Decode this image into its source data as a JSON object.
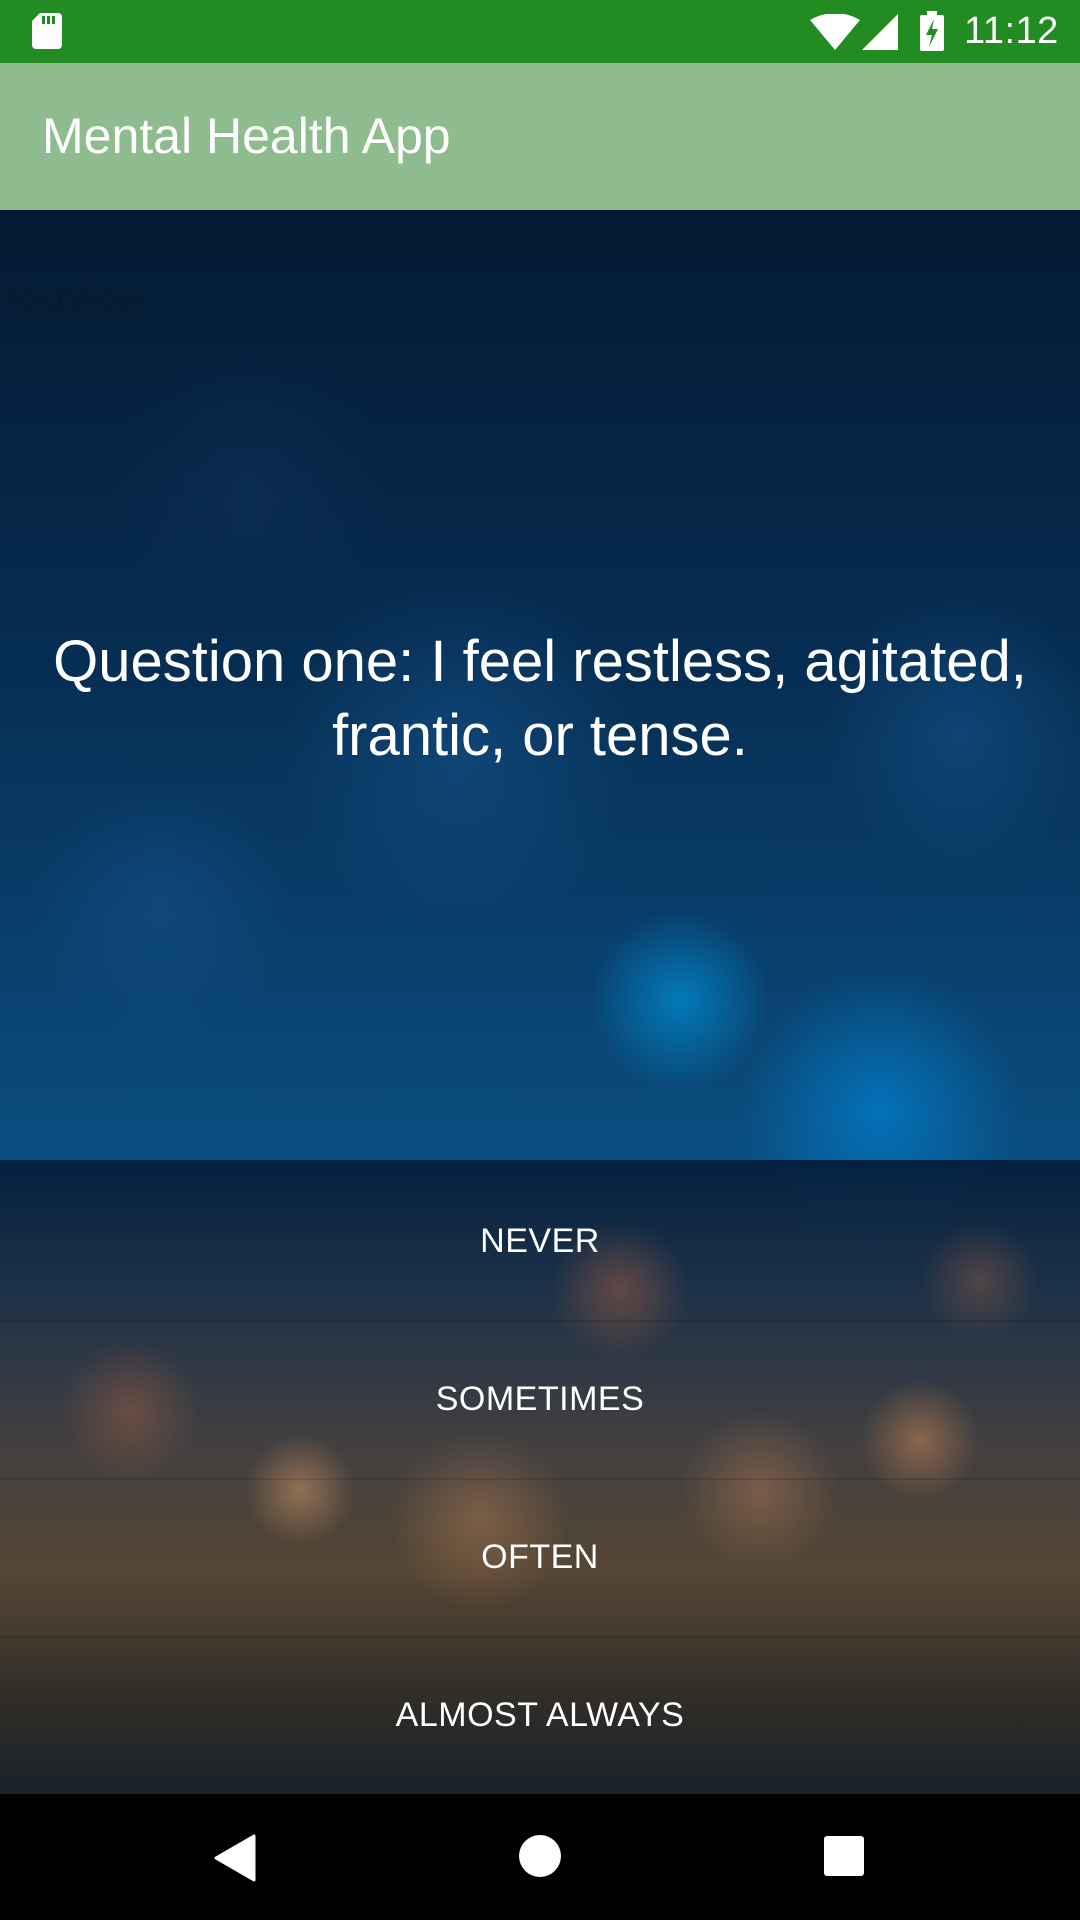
{
  "status_bar": {
    "time": "11:12",
    "icons": [
      "sd-card-icon",
      "wifi-icon",
      "signal-icon",
      "battery-charging-icon"
    ]
  },
  "app_bar": {
    "title": "Mental Health App",
    "color": "#8fbc8f"
  },
  "content": {
    "textview_label": "TextView",
    "question": "Question one: I feel restless, agitated, frantic, or tense."
  },
  "answers": [
    {
      "label": "NEVER"
    },
    {
      "label": "SOMETIMES"
    },
    {
      "label": "OFTEN"
    },
    {
      "label": "ALMOST ALWAYS"
    }
  ],
  "nav_bar": {
    "icons": [
      "back-icon",
      "home-icon",
      "recents-icon"
    ]
  },
  "colors": {
    "status_bar": "#228b22",
    "app_bar": "#8fbc8f"
  }
}
